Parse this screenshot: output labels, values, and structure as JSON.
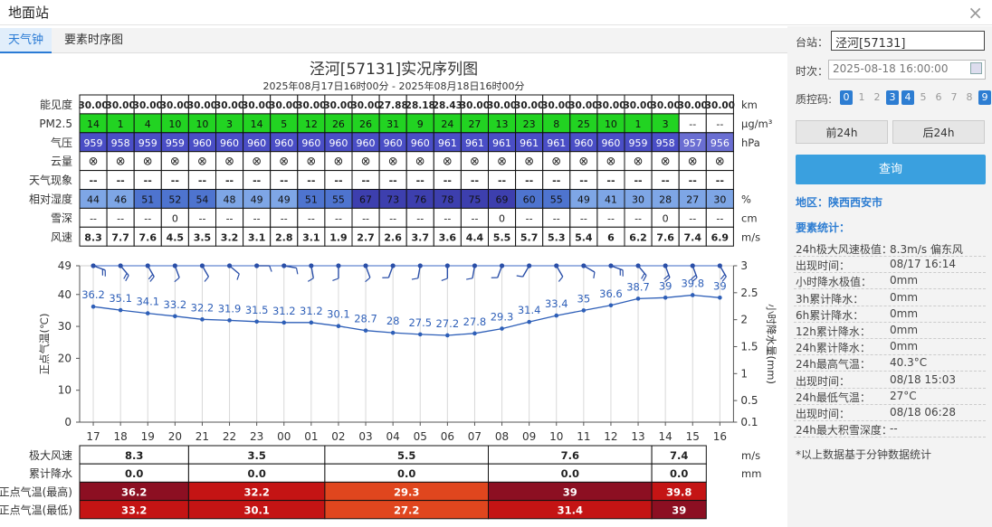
{
  "window": {
    "title": "地面站",
    "close": "×"
  },
  "tabs": [
    "天气钟",
    "要素时序图"
  ],
  "chart_header": {
    "title": "泾河[57131]实况序列图",
    "subtitle": "2025年08月17日16时00分 - 2025年08月18日16时00分"
  },
  "hours": [
    "17",
    "18",
    "19",
    "20",
    "21",
    "22",
    "23",
    "00",
    "01",
    "02",
    "03",
    "04",
    "05",
    "06",
    "07",
    "08",
    "09",
    "10",
    "11",
    "12",
    "13",
    "14",
    "15",
    "16"
  ],
  "table": {
    "rows": [
      {
        "label": "能见度",
        "unit": "km",
        "values": [
          "30.00",
          "30.00",
          "30.00",
          "30.00",
          "30.00",
          "30.00",
          "30.00",
          "30.00",
          "30.00",
          "30.00",
          "30.00",
          "27.88",
          "28.18",
          "28.43",
          "30.00",
          "30.00",
          "30.00",
          "30.00",
          "30.00",
          "30.00",
          "30.00",
          "30.00",
          "30.00",
          "30.00"
        ]
      },
      {
        "label": "PM2.5",
        "unit": "μg/m³",
        "values": [
          "14",
          "1",
          "4",
          "10",
          "10",
          "3",
          "14",
          "5",
          "12",
          "26",
          "26",
          "31",
          "9",
          "24",
          "27",
          "13",
          "23",
          "8",
          "25",
          "10",
          "1",
          "3",
          "--",
          "--"
        ]
      },
      {
        "label": "气压",
        "unit": "hPa",
        "values": [
          "959",
          "958",
          "959",
          "959",
          "960",
          "960",
          "960",
          "960",
          "960",
          "960",
          "960",
          "960",
          "960",
          "961",
          "961",
          "961",
          "961",
          "961",
          "960",
          "960",
          "959",
          "958",
          "957",
          "956"
        ]
      },
      {
        "label": "云量",
        "unit": "",
        "values": [
          "⊗",
          "⊗",
          "⊗",
          "⊗",
          "⊗",
          "⊗",
          "⊗",
          "⊗",
          "⊗",
          "⊗",
          "⊗",
          "⊗",
          "⊗",
          "⊗",
          "⊗",
          "⊗",
          "⊗",
          "⊗",
          "⊗",
          "⊗",
          "⊗",
          "⊗",
          "⊗",
          "⊗"
        ]
      },
      {
        "label": "天气现象",
        "unit": "",
        "values": [
          "--",
          "--",
          "--",
          "--",
          "--",
          "--",
          "--",
          "--",
          "--",
          "--",
          "--",
          "--",
          "--",
          "--",
          "--",
          "--",
          "--",
          "--",
          "--",
          "--",
          "--",
          "--",
          "--",
          "--"
        ]
      },
      {
        "label": "相对湿度",
        "unit": "%",
        "values": [
          "44",
          "46",
          "51",
          "52",
          "54",
          "48",
          "49",
          "49",
          "51",
          "55",
          "67",
          "73",
          "76",
          "78",
          "75",
          "69",
          "60",
          "55",
          "49",
          "41",
          "30",
          "28",
          "27",
          "30"
        ]
      },
      {
        "label": "雪深",
        "unit": "cm",
        "values": [
          "--",
          "--",
          "--",
          "0",
          "--",
          "--",
          "--",
          "--",
          "--",
          "--",
          "--",
          "--",
          "--",
          "--",
          "--",
          "0",
          "--",
          "--",
          "--",
          "--",
          "--",
          "0",
          "--",
          "--"
        ]
      },
      {
        "label": "风速",
        "unit": "m/s",
        "values": [
          "8.3",
          "7.7",
          "7.6",
          "4.5",
          "3.5",
          "3.2",
          "3.1",
          "2.8",
          "3.1",
          "1.9",
          "2.7",
          "2.6",
          "3.7",
          "3.6",
          "4.4",
          "5.5",
          "5.7",
          "5.3",
          "5.4",
          "6",
          "6.2",
          "7.6",
          "7.4",
          "6.9"
        ]
      }
    ]
  },
  "chart_data": {
    "type": "line",
    "x": [
      "17",
      "18",
      "19",
      "20",
      "21",
      "22",
      "23",
      "00",
      "01",
      "02",
      "03",
      "04",
      "05",
      "06",
      "07",
      "08",
      "09",
      "10",
      "11",
      "12",
      "13",
      "14",
      "15",
      "16"
    ],
    "series": [
      {
        "name": "",
        "values": [
          36.2,
          35.1,
          34.1,
          33.2,
          32.2,
          31.9,
          31.5,
          31.2,
          31.2,
          30.1,
          28.7,
          28,
          27.5,
          27.2,
          27.8,
          29.3,
          31.4,
          33.4,
          35,
          36.6,
          38.7,
          39,
          39.8,
          39
        ]
      }
    ],
    "wind_dir": [
      110,
      140,
      150,
      160,
      150,
      130,
      90,
      100,
      170,
      180,
      160,
      200,
      190,
      180,
      190,
      200,
      210,
      150,
      120,
      110,
      140,
      160,
      160,
      150
    ],
    "ylabel": "正点气温(℃)",
    "y2label": "小时降水量(mm)",
    "ylim": [
      0,
      49
    ],
    "yticks": [
      0,
      10,
      20,
      30,
      40,
      49
    ],
    "y2lim": [
      0.1,
      3
    ],
    "y2ticks": [
      "0.1",
      "0.5",
      "1",
      "1.5",
      "2",
      "2.5",
      "3"
    ],
    "grid": true
  },
  "bottom": {
    "rows": [
      {
        "label": "极大风速",
        "unit": "m/s",
        "values": [
          "8.3",
          "3.5",
          "5.5",
          "7.6",
          "7.4"
        ]
      },
      {
        "label": "累计降水",
        "unit": "mm",
        "values": [
          "0.0",
          "0.0",
          "0.0",
          "0.0",
          "0.0"
        ]
      },
      {
        "label": "正点气温(最高)",
        "unit": "",
        "values": [
          "36.2",
          "32.2",
          "29.3",
          "39",
          "39.8"
        ]
      },
      {
        "label": "正点气温(最低)",
        "unit": "",
        "values": [
          "33.2",
          "30.1",
          "27.2",
          "31.4",
          "39"
        ]
      }
    ]
  },
  "side": {
    "station_label": "台站：",
    "station_value": "泾河[57131]",
    "time_label": "时次：",
    "time_value": "2025-08-18 16:00:00",
    "qc_label": "质控码:",
    "qc_codes": [
      "0",
      "1",
      "2",
      "3",
      "4",
      "5",
      "6",
      "7",
      "8",
      "9"
    ],
    "prev": "前24h",
    "next": "后24h",
    "query": "查询",
    "region": "地区：陕西西安市",
    "stats_title": "要素统计：",
    "stats": [
      {
        "k": "24h极大风速极值：",
        "v": "8.3m/s 偏东风"
      },
      {
        "k": "出现时间：",
        "v": "08/17 16:14"
      },
      {
        "k": "小时降水极值：",
        "v": "0mm"
      },
      {
        "k": "3h累计降水：",
        "v": "0mm"
      },
      {
        "k": "6h累计降水：",
        "v": "0mm"
      },
      {
        "k": "12h累计降水：",
        "v": "0mm"
      },
      {
        "k": "24h累计降水：",
        "v": "0mm"
      },
      {
        "k": "24h最高气温：",
        "v": "40.3°C"
      },
      {
        "k": "出现时间：",
        "v": "08/18 15:03"
      },
      {
        "k": "24h最低气温：",
        "v": "27°C"
      },
      {
        "k": "出现时间：",
        "v": "08/18 06:28"
      },
      {
        "k": "24h最大积雪深度：",
        "v": "--"
      }
    ],
    "note": "*以上数据基于分钟数据统计"
  },
  "colors": {
    "accent": "#2d7dd2",
    "pm_green": "#22d322",
    "pressure": "#4a4ec6",
    "hum_dark": "#3d3fae",
    "hum_light": "#7ea6e6",
    "line": "#2e5fb8",
    "hot1": "#c41414",
    "hot2": "#e0461e",
    "hot3": "#8a0f1e"
  }
}
